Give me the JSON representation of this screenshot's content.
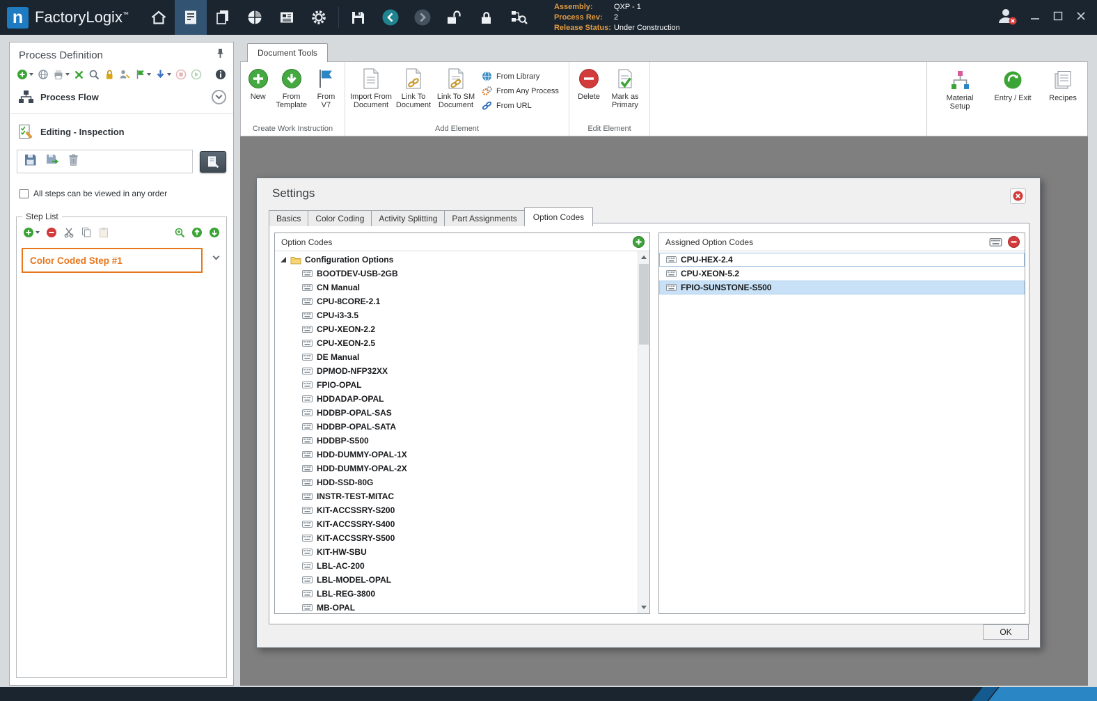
{
  "titlebar": {
    "logo_letter": "n",
    "app_name": "FactoryLogix",
    "trademark": "™",
    "assembly_label": "Assembly:",
    "assembly_value": "QXP - 1",
    "process_rev_label": "Process Rev:",
    "process_rev_value": "2",
    "release_status_label": "Release Status:",
    "release_status_value": "Under Construction"
  },
  "left_panel": {
    "title": "Process Definition",
    "process_flow_label": "Process Flow",
    "editing_label": "Editing - Inspection",
    "order_checkbox_label": "All steps can be viewed in any order",
    "step_list_title": "Step List",
    "steps": [
      {
        "label": "Color Coded Step #1"
      }
    ]
  },
  "ribbon": {
    "tab_label": "Document Tools",
    "create_group": {
      "caption": "Create Work Instruction",
      "new_label": "New",
      "from_template_label": "From Template",
      "from_v7_label": "From V7"
    },
    "add_group": {
      "caption": "Add Element",
      "import_label": "Import From Document",
      "link_doc_label": "Link To Document",
      "link_sm_label": "Link To SM Document",
      "from_library_label": "From Library",
      "from_any_process_label": "From Any Process",
      "from_url_label": "From URL"
    },
    "edit_group": {
      "caption": "Edit Element",
      "delete_label": "Delete",
      "mark_primary_label": "Mark as Primary"
    },
    "material_setup_label": "Material Setup",
    "entry_exit_label": "Entry / Exit",
    "recipes_label": "Recipes"
  },
  "settings_dialog": {
    "title": "Settings",
    "tabs": [
      {
        "label": "Basics"
      },
      {
        "label": "Color Coding"
      },
      {
        "label": "Activity Splitting"
      },
      {
        "label": "Part Assignments"
      },
      {
        "label": "Option Codes",
        "active": true
      }
    ],
    "option_codes_panel": {
      "header": "Option Codes",
      "root_label": "Configuration Options",
      "items": [
        "BOOTDEV-USB-2GB",
        "CN Manual",
        "CPU-8CORE-2.1",
        "CPU-i3-3.5",
        "CPU-XEON-2.2",
        "CPU-XEON-2.5",
        "DE Manual",
        "DPMOD-NFP32XX",
        "FPIO-OPAL",
        "HDDADAP-OPAL",
        "HDDBP-OPAL-SAS",
        "HDDBP-OPAL-SATA",
        "HDDBP-S500",
        "HDD-DUMMY-OPAL-1X",
        "HDD-DUMMY-OPAL-2X",
        "HDD-SSD-80G",
        "INSTR-TEST-MITAC",
        "KIT-ACCSSRY-S200",
        "KIT-ACCSSRY-S400",
        "KIT-ACCSSRY-S500",
        "KIT-HW-SBU",
        "LBL-AC-200",
        "LBL-MODEL-OPAL",
        "LBL-REG-3800",
        "MB-OPAL"
      ]
    },
    "assigned_panel": {
      "header": "Assigned Option Codes",
      "items": [
        {
          "label": "CPU-HEX-2.4",
          "state": "focused"
        },
        {
          "label": "CPU-XEON-5.2",
          "state": "normal"
        },
        {
          "label": "FPIO-SUNSTONE-S500",
          "state": "selected"
        }
      ]
    },
    "ok_label": "OK"
  },
  "colors": {
    "titlebar_bg": "#1A2530",
    "accent_blue": "#1E7BC2",
    "canvas_gray": "#7F7F7F",
    "selection_blue": "#C8E1F6",
    "step_orange": "#E8761B",
    "info_label_orange": "#E39B40"
  },
  "icons": [
    "home-icon",
    "work-instructions-icon",
    "documents-icon",
    "production-icon",
    "news-icon",
    "gear-icon",
    "save-icon",
    "back-icon",
    "forward-icon",
    "unlock-icon",
    "lock-icon",
    "process-search-icon",
    "user-logout-icon",
    "minimize-icon",
    "maximize-icon",
    "close-icon",
    "pin-icon",
    "process-flow-icon",
    "editing-checklist-icon",
    "trash-icon",
    "folder-icon",
    "keyboard-icon",
    "add-icon",
    "remove-icon",
    "chevron-down-icon"
  ]
}
